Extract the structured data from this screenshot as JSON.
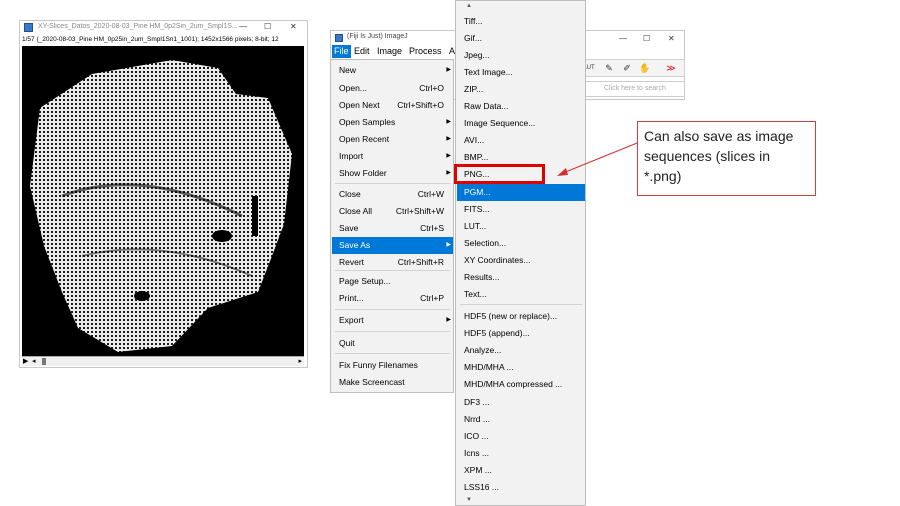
{
  "image_window": {
    "title": "XY-Slices_Datos_2020-08-03_Pine HM_0p2Sin_2um_Smpl1S...",
    "info": "1/57 (_2020-08-03_Pine HM_0p25in_2um_Smpl1Sn1_1001); 1452x1566 pixels; 8-bit; 12",
    "minimize": "—",
    "maximize": "☐",
    "close": "✕",
    "scroll_play": "▶",
    "scroll_left": "◂",
    "scroll_right": "▸"
  },
  "fiji_window": {
    "title": "(Fiji Is Just) ImageJ",
    "menubar": [
      "File",
      "Edit",
      "Image",
      "Process",
      "A"
    ],
    "minimize": "—",
    "maximize": "☐",
    "close": "✕",
    "tools": [
      "LUT",
      "✎",
      "✐",
      "✋",
      "≫"
    ],
    "search_placeholder": "Click here to search"
  },
  "file_menu": [
    {
      "label": "New",
      "shortcut": "",
      "submenu": true
    },
    {
      "label": "Open...",
      "shortcut": "Ctrl+O",
      "submenu": false
    },
    {
      "label": "Open Next",
      "shortcut": "Ctrl+Shift+O",
      "submenu": false
    },
    {
      "label": "Open Samples",
      "shortcut": "",
      "submenu": true
    },
    {
      "label": "Open Recent",
      "shortcut": "",
      "submenu": true
    },
    {
      "label": "Import",
      "shortcut": "",
      "submenu": true
    },
    {
      "label": "Show Folder",
      "shortcut": "",
      "submenu": true
    },
    {
      "label": "Close",
      "shortcut": "Ctrl+W",
      "submenu": false
    },
    {
      "label": "Close All",
      "shortcut": "Ctrl+Shift+W",
      "submenu": false
    },
    {
      "label": "Save",
      "shortcut": "Ctrl+S",
      "submenu": false
    },
    {
      "label": "Save As",
      "shortcut": "",
      "submenu": true,
      "highlighted": true
    },
    {
      "label": "Revert",
      "shortcut": "Ctrl+Shift+R",
      "submenu": false
    },
    {
      "label": "Page Setup...",
      "shortcut": "",
      "submenu": false
    },
    {
      "label": "Print...",
      "shortcut": "Ctrl+P",
      "submenu": false
    },
    {
      "label": "Export",
      "shortcut": "",
      "submenu": true
    },
    {
      "label": "Quit",
      "shortcut": "",
      "submenu": false
    },
    {
      "label": "Fix Funny Filenames",
      "shortcut": "",
      "submenu": false
    },
    {
      "label": "Make Screencast",
      "shortcut": "",
      "submenu": false
    }
  ],
  "save_as_menu": [
    "Tiff...",
    "Gif...",
    "Jpeg...",
    "Text Image...",
    "ZIP...",
    "Raw Data...",
    "Image Sequence...",
    "AVI...",
    "BMP...",
    "PNG...",
    "PGM...",
    "FITS...",
    "LUT...",
    "Selection...",
    "XY Coordinates...",
    "Results...",
    "Text...",
    "HDF5 (new or replace)...",
    "HDF5 (append)...",
    "Analyze...",
    "MHD/MHA ...",
    "MHD/MHA compressed ...",
    "DF3 ...",
    "Nrrd ...",
    "ICO ...",
    "Icns ...",
    "XPM ...",
    "LSS16 ..."
  ],
  "save_as_highlighted": "PGM...",
  "save_as_boxed": "PNG...",
  "submenu_up": "▲",
  "submenu_down": "▼",
  "note": "Can also save as image sequences (slices in *.png)",
  "colors": {
    "highlight": "#0078d7",
    "annotation_red": "#e00000"
  }
}
